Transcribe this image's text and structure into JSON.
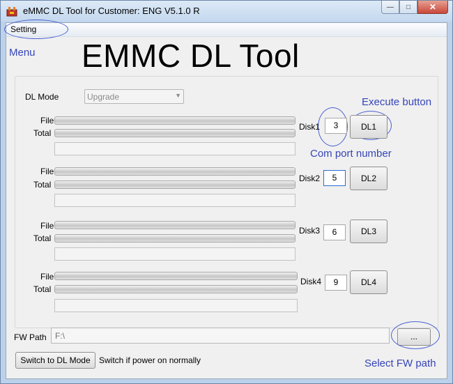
{
  "window": {
    "title": "eMMC DL Tool for Customer: ENG V5.1.0 R",
    "minimize_label": "—",
    "maximize_label": "□",
    "close_label": "✕"
  },
  "menu": {
    "setting": "Setting"
  },
  "app_title": "EMMC DL Tool",
  "annotations": {
    "menu": "Menu",
    "execute": "Execute button",
    "com_port": "Com port number",
    "select_fw": "Select FW path"
  },
  "dl_mode": {
    "label": "DL Mode",
    "value": "Upgrade"
  },
  "disks": [
    {
      "file_label": "File",
      "total_label": "Total",
      "disk_label": "Disk1",
      "port": "3",
      "button": "DL1",
      "file_progress": 1.0,
      "total_progress": 1.0
    },
    {
      "file_label": "File",
      "total_label": "Total",
      "disk_label": "Disk2",
      "port": "5",
      "button": "DL2",
      "file_progress": 1.0,
      "total_progress": 1.0
    },
    {
      "file_label": "File",
      "total_label": "Total",
      "disk_label": "Disk3",
      "port": "6",
      "button": "DL3",
      "file_progress": 1.0,
      "total_progress": 1.0
    },
    {
      "file_label": "File",
      "total_label": "Total",
      "disk_label": "Disk4",
      "port": "9",
      "button": "DL4",
      "file_progress": 1.0,
      "total_progress": 1.0
    }
  ],
  "fw_path": {
    "label": "FW Path",
    "value": "F:\\",
    "browse_label": "..."
  },
  "bottom": {
    "switch_button": "Switch to DL Mode",
    "switch_hint": "Switch if power on normally"
  }
}
